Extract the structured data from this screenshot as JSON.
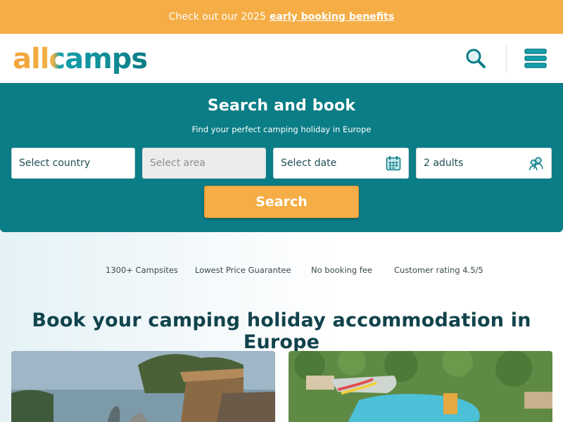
{
  "promo": {
    "text": "Check out our 2025",
    "link": "early booking benefits"
  },
  "header": {
    "logo_text": "allcamps",
    "search_icon": "search-icon",
    "menu_icon": "hamburger-menu-icon"
  },
  "search": {
    "title": "Search and book",
    "subtitle": "Find your perfect camping holiday in Europe",
    "country": "Select country",
    "area": "Select area",
    "date": "Select date",
    "guests": "2 adults",
    "button": "Search"
  },
  "usps": [
    "1300+ Campsites",
    "Lowest Price Guarantee",
    "No booking fee",
    "Customer rating 4.5/5"
  ],
  "main": {
    "heading": "Book your camping holiday accommodation in Europe"
  },
  "colors": {
    "accent": "#f5ad45",
    "brand_teal": "#0b7d86",
    "heading": "#11434c"
  }
}
